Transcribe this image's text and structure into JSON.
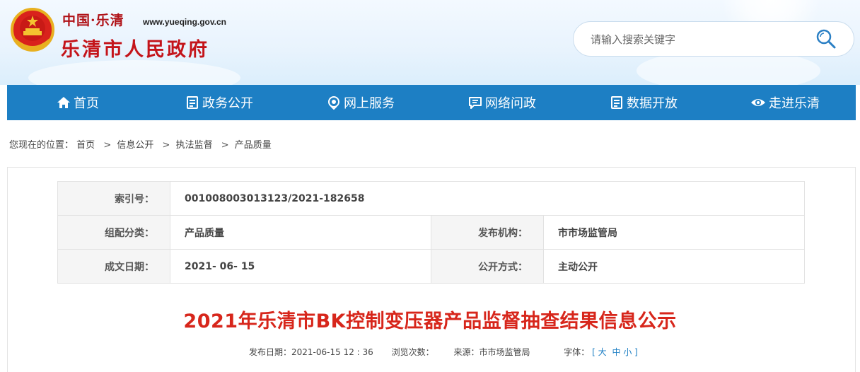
{
  "header": {
    "brand_top": "中国·乐清",
    "brand_url": "www.yueqing.gov.cn",
    "brand_name": "乐清市人民政府",
    "search_placeholder": "请输入搜索关键字"
  },
  "nav": {
    "items": [
      {
        "label": "首页",
        "icon": "home-icon"
      },
      {
        "label": "政务公开",
        "icon": "document-icon"
      },
      {
        "label": "网上服务",
        "icon": "service-icon"
      },
      {
        "label": "网络问政",
        "icon": "chat-icon"
      },
      {
        "label": "数据开放",
        "icon": "database-icon"
      },
      {
        "label": "走进乐清",
        "icon": "eye-icon"
      }
    ]
  },
  "breadcrumb": {
    "prefix": "您现在的位置：",
    "items": [
      "首页",
      "信息公开",
      "执法监督",
      "产品质量"
    ]
  },
  "meta": {
    "index_label": "索引号：",
    "index_value": "001008003013123/2021-182658",
    "category_label": "组配分类：",
    "category_value": "产品质量",
    "publisher_label": "发布机构：",
    "publisher_value": "市市场监管局",
    "date_label": "成文日期：",
    "date_value": "2021- 06- 15",
    "method_label": "公开方式：",
    "method_value": "主动公开"
  },
  "article": {
    "title": "2021年乐清市BK控制变压器产品监督抽查结果信息公示",
    "publish_date": "发布日期：2021-06-15 12 : 36",
    "views": "浏览次数：",
    "source": "来源：市市场监管局",
    "font_label": "字体：",
    "font_open": "[",
    "font_large": "大",
    "font_medium": "中",
    "font_small": "小",
    "font_close": "]"
  },
  "colors": {
    "nav_bg": "#1d7fc4",
    "title_red": "#d7261b",
    "brand_red": "#c4141a"
  }
}
